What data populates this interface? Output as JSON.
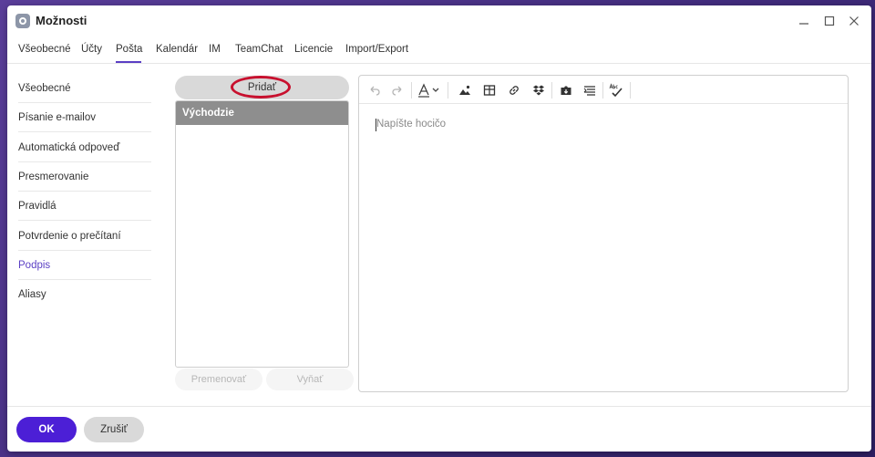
{
  "window": {
    "title": "Možnosti",
    "app_icon": "settings-app-icon",
    "controls": [
      "minimize-icon",
      "maximize-icon",
      "close-icon"
    ]
  },
  "tabs": [
    {
      "label": "Všeobecné"
    },
    {
      "label": "Účty"
    },
    {
      "label": "Pošta",
      "active": true
    },
    {
      "label": "Kalendár"
    },
    {
      "label": "IM"
    },
    {
      "label": "TeamChat"
    },
    {
      "label": "Licencie"
    },
    {
      "label": "Import/Export"
    }
  ],
  "sidebar": {
    "items": [
      {
        "label": "Všeobecné"
      },
      {
        "label": "Písanie e-mailov"
      },
      {
        "label": "Automatická odpoveď"
      },
      {
        "label": "Presmerovanie"
      },
      {
        "label": "Pravidlá"
      },
      {
        "label": "Potvrdenie o prečítaní"
      },
      {
        "label": "Podpis",
        "active": true
      },
      {
        "label": "Aliasy"
      }
    ]
  },
  "signatures": {
    "add_label": "Pridať",
    "items": [
      {
        "label": "Východzie",
        "selected": true
      }
    ],
    "rename_label": "Premenovať",
    "delete_label": "Vyňať"
  },
  "editor": {
    "placeholder": "Napíšte hocičo",
    "toolbar_icons": [
      "undo-icon",
      "redo-icon",
      "text-color-icon",
      "image-icon",
      "table-icon",
      "link-icon",
      "dropbox-icon",
      "insert-file-icon",
      "align-icon",
      "spellcheck-icon"
    ]
  },
  "footer": {
    "ok_label": "OK",
    "cancel_label": "Zrušiť"
  },
  "colors": {
    "accent": "#5b3fc4",
    "ok_button": "#4c1fd6",
    "highlight_ring": "#c8102e",
    "selected_row": "#8e8e8e"
  }
}
